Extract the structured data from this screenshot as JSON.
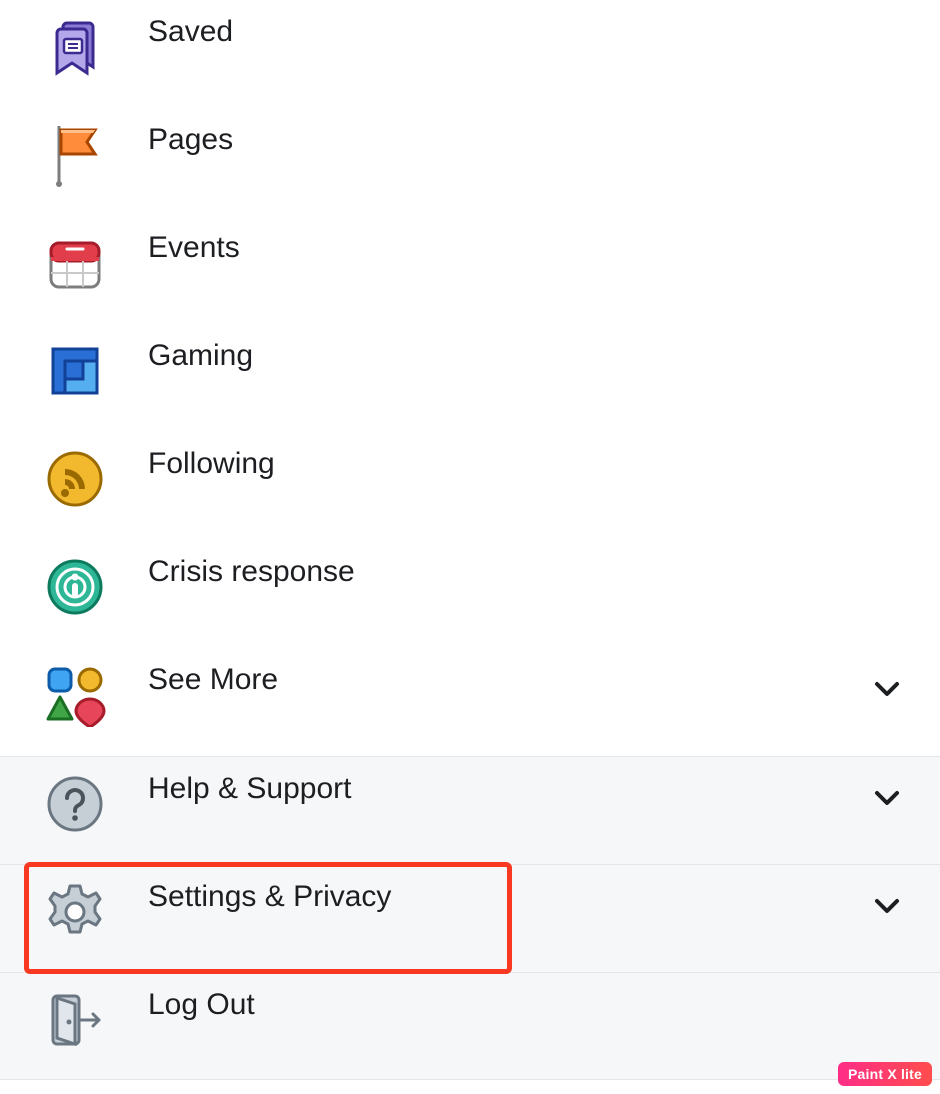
{
  "menu": {
    "items": [
      {
        "key": "saved",
        "label": "Saved",
        "chevron": false,
        "grey": false
      },
      {
        "key": "pages",
        "label": "Pages",
        "chevron": false,
        "grey": false
      },
      {
        "key": "events",
        "label": "Events",
        "chevron": false,
        "grey": false
      },
      {
        "key": "gaming",
        "label": "Gaming",
        "chevron": false,
        "grey": false
      },
      {
        "key": "following",
        "label": "Following",
        "chevron": false,
        "grey": false
      },
      {
        "key": "crisis",
        "label": "Crisis response",
        "chevron": false,
        "grey": false
      },
      {
        "key": "seemore",
        "label": "See More",
        "chevron": true,
        "grey": false
      },
      {
        "key": "help",
        "label": "Help & Support",
        "chevron": true,
        "grey": true
      },
      {
        "key": "settings",
        "label": "Settings & Privacy",
        "chevron": true,
        "grey": true
      },
      {
        "key": "logout",
        "label": "Log Out",
        "chevron": false,
        "grey": true
      }
    ]
  },
  "watermark": "Paint X lite",
  "highlight_target": "settings"
}
